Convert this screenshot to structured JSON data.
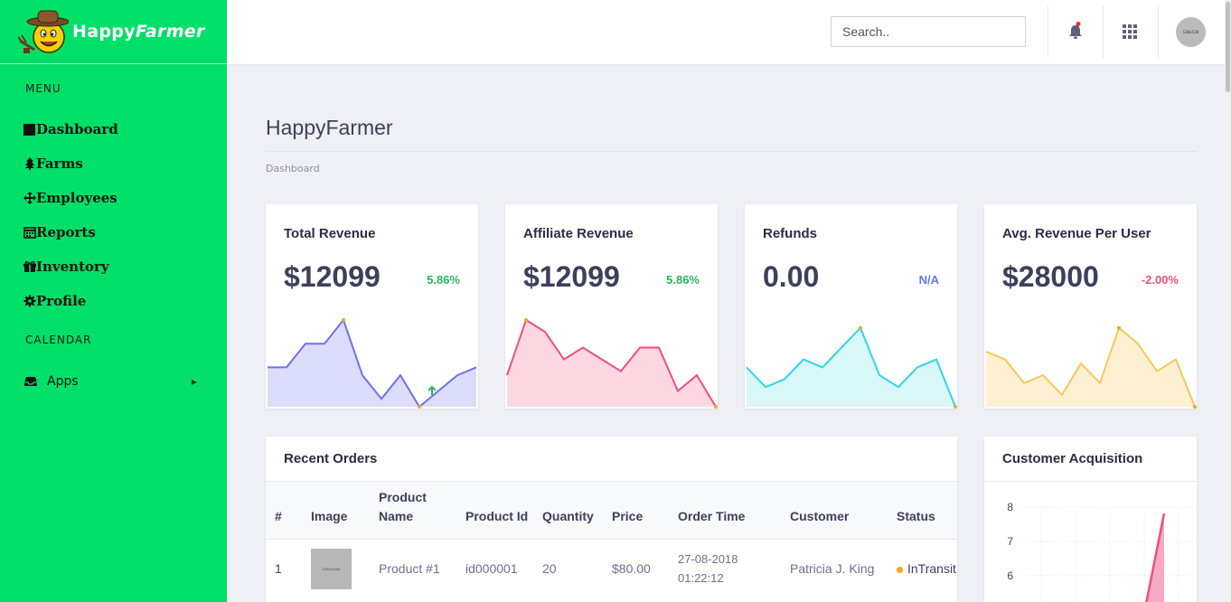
{
  "brand": {
    "name_plain": "Happy",
    "name_italic": "Farmer"
  },
  "sidebar": {
    "menu_heading": "MENU",
    "items": [
      {
        "label": "Dashboard",
        "icon": "square-icon"
      },
      {
        "label": "Farms",
        "icon": "tree-icon"
      },
      {
        "label": "Employees",
        "icon": "move-icon"
      },
      {
        "label": "Reports",
        "icon": "calendar-icon"
      },
      {
        "label": "Inventory",
        "icon": "gift-icon"
      },
      {
        "label": "Profile",
        "icon": "gear-icon"
      }
    ],
    "calendar_heading": "CALENDAR",
    "apps_label": "Apps"
  },
  "topbar": {
    "search_placeholder": "Search..",
    "avatar_text": "128x128"
  },
  "page": {
    "title": "HappyFarmer",
    "breadcrumb": "Dashboard"
  },
  "stats": [
    {
      "title": "Total Revenue",
      "value": "$12099",
      "delta": "5.86%",
      "trend": "up",
      "color": "#6c72f0",
      "fill": "#dcdcfb",
      "points": [
        5,
        5,
        8,
        8,
        11,
        4,
        1,
        4,
        0,
        2,
        4,
        5
      ]
    },
    {
      "title": "Affiliate Revenue",
      "value": "$12099",
      "delta": "5.86%",
      "trend": "up",
      "color": "#ef4f7e",
      "fill": "#fdd8e3",
      "points": [
        4,
        11,
        9.5,
        6,
        7.5,
        6,
        4.5,
        7.5,
        7.5,
        2,
        4,
        0
      ]
    },
    {
      "title": "Refunds",
      "value": "0.00",
      "delta": "N/A",
      "trend": "none",
      "color": "#2ed7ea",
      "fill": "#daf7fa",
      "points": [
        5,
        2.5,
        3.5,
        6,
        5,
        7.5,
        10,
        4,
        2.5,
        5,
        6,
        0
      ]
    },
    {
      "title": "Avg. Revenue Per User",
      "value": "$28000",
      "delta": "-2.00%",
      "trend": "down",
      "color": "#f7c85c",
      "fill": "#fef0d3",
      "points": [
        7,
        6,
        3,
        4,
        1.5,
        5.5,
        3,
        10,
        8,
        4.5,
        6,
        0
      ]
    }
  ],
  "colors": {
    "up": "#27b862",
    "down": "#ef4f7e",
    "none": "#6c72f0",
    "endpoint": "#f5a623"
  },
  "orders": {
    "title": "Recent Orders",
    "columns": [
      "#",
      "Image",
      "Product Name",
      "Product Id",
      "Quantity",
      "Price",
      "Order Time",
      "Customer",
      "Status"
    ],
    "rows": [
      {
        "num": "1",
        "image": "1200x1200",
        "name": "Product #1",
        "id": "id000001",
        "qty": "20",
        "price": "$80.00",
        "time_date": "27-08-2018",
        "time_clock": "01:22:12",
        "customer": "Patricia J. King",
        "status": "InTransit"
      }
    ]
  },
  "acquisition": {
    "title": "Customer Acquisition",
    "chart_data": {
      "type": "area",
      "y_ticks": [
        "8",
        "7",
        "6"
      ],
      "ylim": [
        5,
        8
      ],
      "series": [
        {
          "color": "#ef4f7e"
        }
      ]
    }
  }
}
